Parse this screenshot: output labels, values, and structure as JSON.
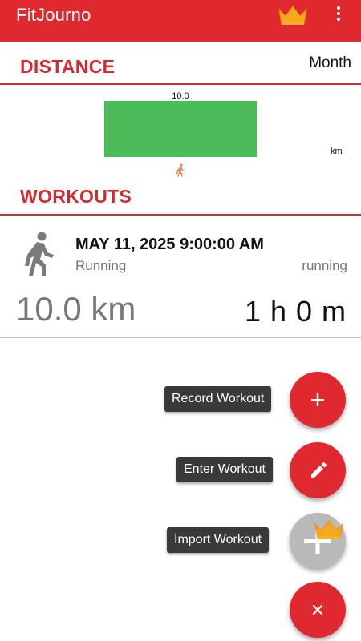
{
  "app": {
    "title": "FitJourno",
    "accent": "#e0292e",
    "premium_icon": "crown-icon",
    "menu_icon": "more-vert-icon"
  },
  "distance_section": {
    "title": "DISTANCE",
    "period": "Month"
  },
  "chart_data": {
    "type": "bar",
    "categories": [
      "running"
    ],
    "values": [
      10.0
    ],
    "data_labels": [
      "10.0"
    ],
    "ylabel": "km",
    "category_icon": "running-icon",
    "bar_color": "#4cbb5a",
    "grid": false
  },
  "workouts_section": {
    "title": "WORKOUTS"
  },
  "workouts": [
    {
      "date": "MAY 11, 2025 9:00:00 AM",
      "type": "Running",
      "tag": "running",
      "distance": "10.0 km",
      "duration": "1 h 0 m",
      "icon": "running-icon"
    }
  ],
  "fab_menu": {
    "record": {
      "label": "Record Workout",
      "icon": "plus-icon"
    },
    "enter": {
      "label": "Enter Workout",
      "icon": "pencil-icon"
    },
    "import": {
      "label": "Import Workout",
      "icon": "plus-icon",
      "badge": "crown-icon",
      "disabled": true
    },
    "close": {
      "icon": "close-icon"
    }
  }
}
